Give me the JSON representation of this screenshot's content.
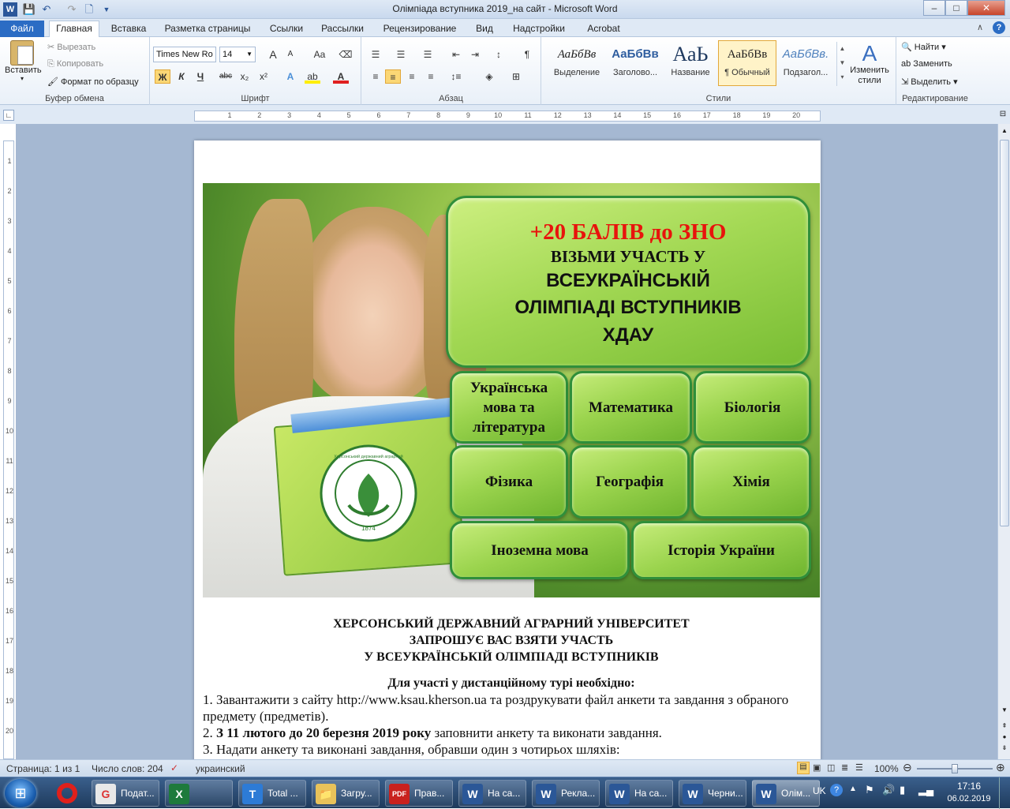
{
  "window": {
    "title": "Олімпіада вступника 2019_на сайт  -  Microsoft Word",
    "min": "–",
    "max": "□",
    "close": "✕"
  },
  "tabs": [
    "Файл",
    "Главная",
    "Вставка",
    "Разметка страницы",
    "Ссылки",
    "Рассылки",
    "Рецензирование",
    "Вид",
    "Надстройки",
    "Acrobat"
  ],
  "clipboard": {
    "paste": "Вставить",
    "cut": "Вырезать",
    "copy": "Копировать",
    "format_painter": "Формат по образцу",
    "label": "Буфер обмена"
  },
  "font": {
    "name": "Times New Ro",
    "size": "14",
    "label": "Шрифт",
    "bold": "Ж",
    "italic": "К",
    "underline": "Ч",
    "strike": "abc",
    "sub": "x₂",
    "sup": "x²",
    "grow": "A",
    "shrink": "A",
    "case": "Aa"
  },
  "paragraph": {
    "label": "Абзац",
    "pilcrow": "¶"
  },
  "styles": {
    "label": "Стили",
    "items": [
      {
        "sample": "АаБбВв",
        "name": "Выделение"
      },
      {
        "sample": "АаБбВв",
        "name": "Заголово..."
      },
      {
        "sample": "АаЬ",
        "name": "Название"
      },
      {
        "sample": "АаБбВв",
        "name": "¶ Обычный"
      },
      {
        "sample": "АаБбВв.",
        "name": "Подзагол..."
      }
    ],
    "change": "Изменить стили"
  },
  "editing": {
    "label": "Редактирование",
    "find": "Найти",
    "replace": "Заменить",
    "select": "Выделить"
  },
  "ruler": {
    "top_numbers": [
      "1",
      "2",
      "3",
      "4",
      "5",
      "6",
      "7",
      "8",
      "9",
      "10",
      "11",
      "12",
      "13",
      "14",
      "15",
      "16",
      "17",
      "18",
      "19",
      "20"
    ],
    "side_numbers": [
      "1",
      "2",
      "3",
      "4",
      "5",
      "6",
      "7",
      "8",
      "9",
      "10",
      "11",
      "12",
      "13",
      "14",
      "15",
      "16",
      "17",
      "18",
      "19",
      "20"
    ]
  },
  "banner": {
    "bonus": "+20 БАЛІВ до ЗНО",
    "line1": "ВІЗЬМИ УЧАСТЬ У",
    "line2": "ВСЕУКРАЇНСЬКІЙ",
    "line3": "ОЛІМПІАДІ ВСТУПНИКІВ",
    "line4": "ХДАУ",
    "logo_text": "Херсонський державний аграрний університет • Україна",
    "logo_year": "1874",
    "subjects": [
      "Українська мова та література",
      "Математика",
      "Біологія",
      "Фізика",
      "Географія",
      "Хімія",
      "Іноземна  мова",
      "Історія  України"
    ]
  },
  "document": {
    "h1": "ХЕРСОНСЬКИЙ ДЕРЖАВНИЙ АГРАРНИЙ УНІВЕРСИТЕТ",
    "h2": "ЗАПРОШУЄ ВАС ВЗЯТИ УЧАСТЬ",
    "h3": "У ВСЕУКРАЇНСЬКІЙ ОЛІМПІАДІ ВСТУПНИКІВ",
    "intro": "Для участі у дистанційному турі необхідно:",
    "p1": "1. Завантажити з сайту http://www.ksau.kherson.ua та роздрукувати файл анкети та завдання з обраного предмету (предметів).",
    "p2_prefix": "2. ",
    "p2_bold": "З 11 лютого до 20 березня 2019 року",
    "p2_rest": "  заповнити анкету та виконати завдання.",
    "p3": "3. Надати анкету та виконані завдання, обравши один з чотирьох шляхів:"
  },
  "status": {
    "page": "Страница: 1 из 1",
    "words": "Число слов: 204",
    "lang": "украинский",
    "zoom": "100%",
    "zoom_level": 0.5
  },
  "taskbar": {
    "items": [
      {
        "icon": "G",
        "label": "Подат...",
        "color": "#e8e8e8"
      },
      {
        "icon": "X",
        "label": "",
        "color": "#1e7a3c"
      },
      {
        "icon": "T",
        "label": "Total ...",
        "color": "#2d7bd6"
      },
      {
        "icon": "📁",
        "label": "Загру...",
        "color": "#e8c25a"
      },
      {
        "icon": "PDF",
        "label": "Прав...",
        "color": "#c9211e"
      },
      {
        "icon": "W",
        "label": "На са...",
        "color": "#2b5797"
      },
      {
        "icon": "W",
        "label": "Рекла...",
        "color": "#2b5797"
      },
      {
        "icon": "W",
        "label": "На са...",
        "color": "#2b5797"
      },
      {
        "icon": "W",
        "label": "Черни...",
        "color": "#2b5797"
      },
      {
        "icon": "W",
        "label": "Олім...",
        "color": "#2b5797"
      }
    ],
    "lang": "UK",
    "time": "17:16",
    "date": "06.02.2019"
  }
}
